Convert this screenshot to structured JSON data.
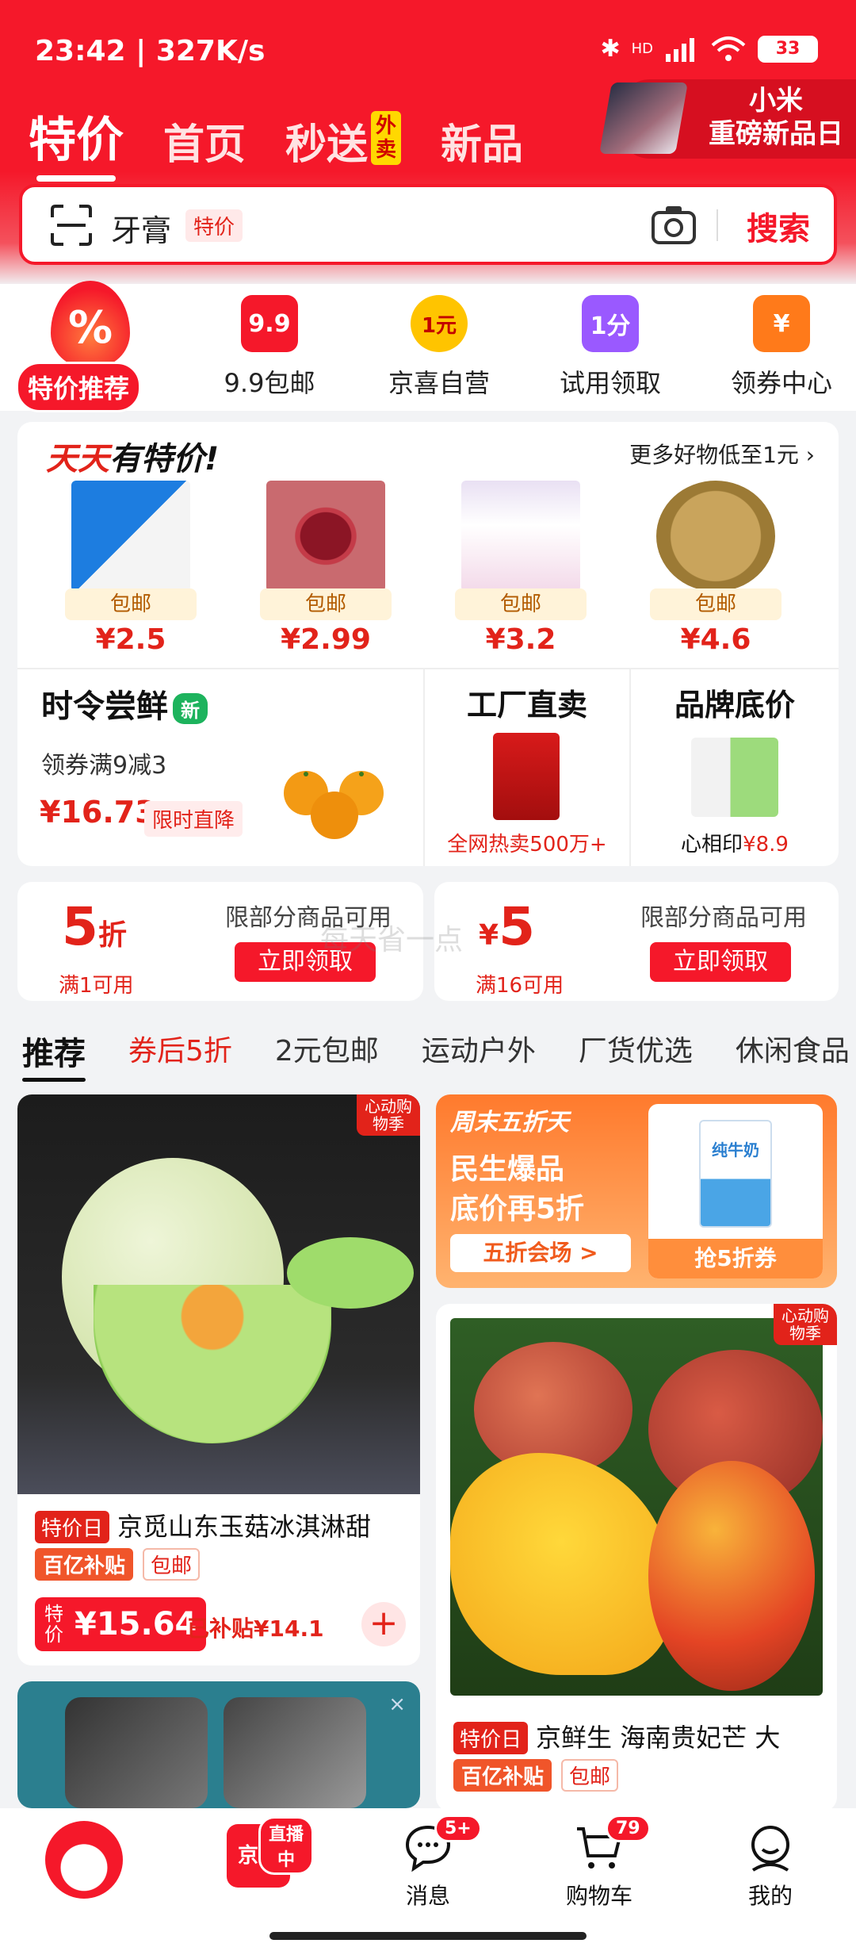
{
  "status_bar": {
    "time": "23:42",
    "speed": "327K/s",
    "network": "HD",
    "battery": "33"
  },
  "top_tabs": [
    {
      "label": "特价"
    },
    {
      "label": "首页"
    },
    {
      "label": "秒送",
      "badge": "外卖"
    },
    {
      "label": "新品"
    }
  ],
  "promo_banner": {
    "line1": "小米",
    "line2": "重磅新品日"
  },
  "search": {
    "query": "牙膏",
    "tag": "特价",
    "button": "搜索"
  },
  "categories": [
    {
      "label": "特价推荐",
      "icon": "%"
    },
    {
      "label": "9.9包邮",
      "icon": "9.9"
    },
    {
      "label": "京喜自营",
      "icon": "1元"
    },
    {
      "label": "试用领取",
      "icon": "1分"
    },
    {
      "label": "领券中心",
      "icon": "¥"
    }
  ],
  "daily_deals": {
    "title_red": "天天",
    "title_black": "有特价!",
    "more": "更多好物低至1元",
    "items": [
      {
        "tag": "包邮",
        "price": "¥2.5"
      },
      {
        "tag": "包邮",
        "price": "¥2.99"
      },
      {
        "tag": "包邮",
        "price": "¥3.2"
      },
      {
        "tag": "包邮",
        "price": "¥4.6"
      }
    ]
  },
  "fresh": {
    "title": "时令尝鲜",
    "badge": "新",
    "subtitle": "领券满9减3",
    "price": "¥16.73",
    "tag": "限时直降"
  },
  "factory": {
    "title": "工厂直卖",
    "footer": "全网热卖500万+"
  },
  "brand": {
    "title": "品牌底价",
    "footer_name": "心相印",
    "footer_price": "¥8.9"
  },
  "coupons": [
    {
      "value_num": "5",
      "value_unit": "折",
      "condition": "满1可用",
      "note": "限部分商品可用",
      "button": "立即领取"
    },
    {
      "value_num": "5",
      "value_unit": "¥",
      "condition": "满16可用",
      "note": "限部分商品可用",
      "button": "立即领取"
    }
  ],
  "watermark": "每天省一点",
  "feed_tabs": [
    "推荐",
    "券后5折",
    "2元包邮",
    "运动户外",
    "厂货优选",
    "休闲食品"
  ],
  "products": [
    {
      "corner": "心动购物季",
      "day_tag": "特价日",
      "title": "京觅山东玉菇冰淇淋甜",
      "sub_a": "百亿补贴",
      "sub_b": "包邮",
      "price_label": "特价",
      "price": "¥15.64",
      "subsidy": "已补贴¥14.1"
    },
    {
      "corner": "心动购物季",
      "day_tag": "特价日",
      "title": "京鲜生 海南贵妃芒 大",
      "sub_a": "百亿补贴",
      "sub_b": "包邮"
    }
  ],
  "weekend": {
    "title": "周末五折天",
    "line1": "民生爆品",
    "line2": "底价再5折",
    "button": "五折会场 >",
    "card_button": "抢5折券",
    "milk": "纯牛奶"
  },
  "bottom_nav": [
    {
      "label": ""
    },
    {
      "label": "",
      "badge": "直播中",
      "name": "京喜"
    },
    {
      "label": "消息",
      "badge": "5+"
    },
    {
      "label": "购物车",
      "badge": "79"
    },
    {
      "label": "我的"
    }
  ],
  "colors": {
    "brand_red": "#f5182a",
    "accent_orange": "#ff7a2d"
  }
}
